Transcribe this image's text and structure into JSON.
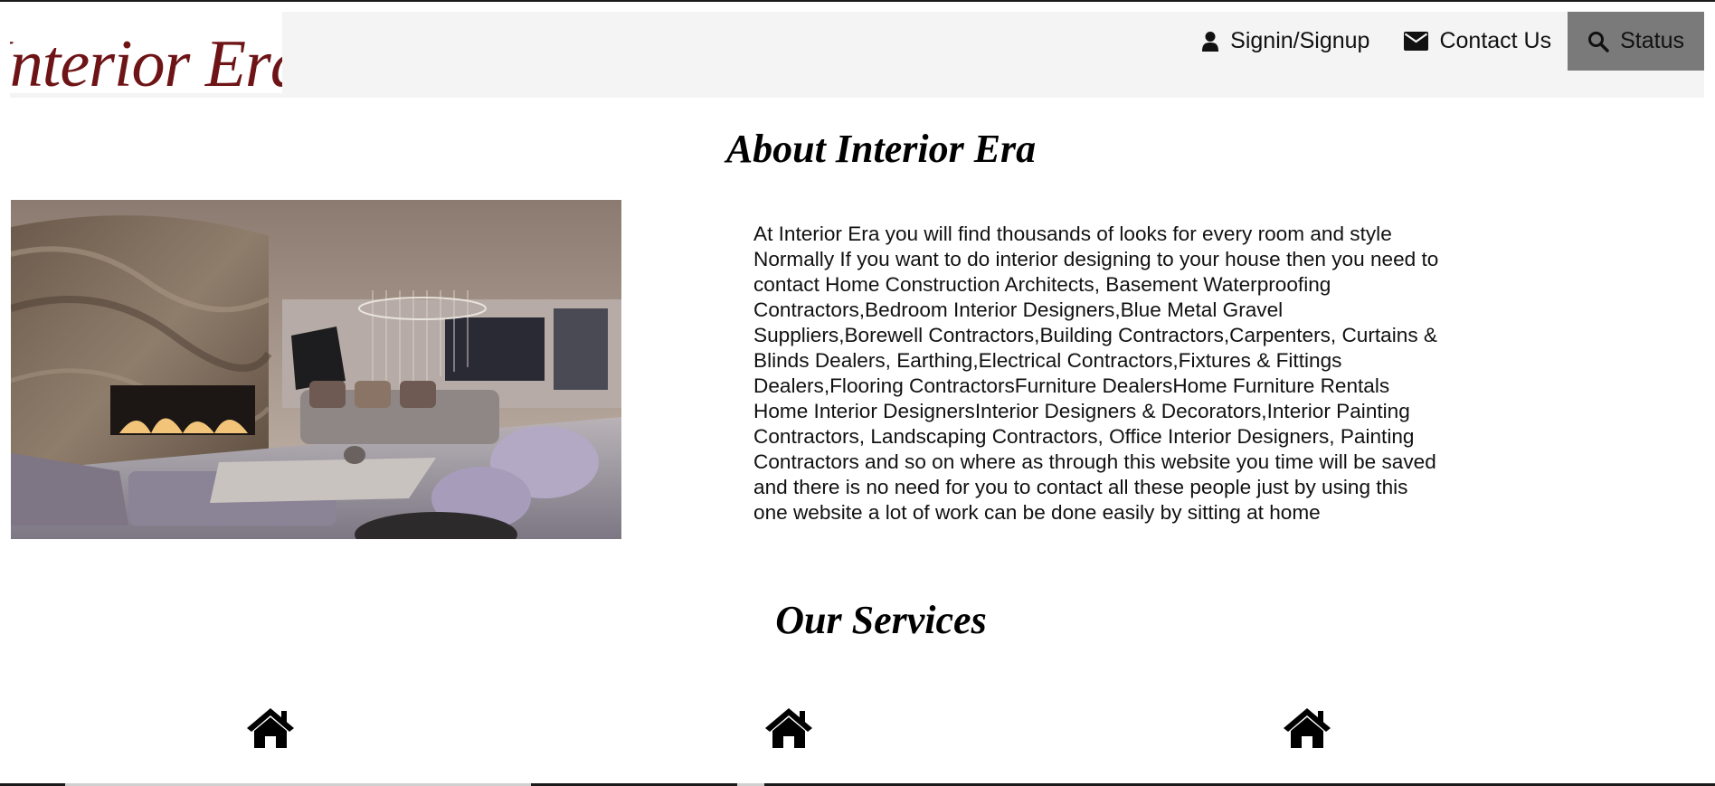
{
  "brand": {
    "logo_text": "Interior Era",
    "logo_color": "#6e1416"
  },
  "nav": {
    "items": [
      {
        "label": "Signin/Signup",
        "icon": "user-icon"
      },
      {
        "label": "Contact Us",
        "icon": "envelope-icon"
      },
      {
        "label": "Status",
        "icon": "search-icon"
      }
    ],
    "status_bg": "#7a7a7a",
    "bar_bg": "#f4f4f4"
  },
  "about": {
    "title": "About Interior Era",
    "image_alt": "living-room-interior-image",
    "text": "At Interior Era you will find thousands of looks for every room and style Normally If you want to do interior designing to your house then you need to contact Home Construction Architects, Basement Waterproofing Contractors,Bedroom Interior Designers,Blue Metal Gravel Suppliers,Borewell Contractors,Building Contractors,Carpenters, Curtains & Blinds Dealers, Earthing,Electrical Contractors,Fixtures & Fittings Dealers,Flooring ContractorsFurniture DealersHome Furniture Rentals Home Interior DesignersInterior Designers & Decorators,Interior Painting Contractors, Landscaping Contractors, Office Interior Designers, Painting Contractors and so on where as through this website you time will be saved and there is no need for you to contact all these people just by using this one website a lot of work can be done easily by sitting at home"
  },
  "services": {
    "title": "Our Services",
    "icons": [
      "home-icon",
      "home-icon",
      "home-icon"
    ]
  }
}
